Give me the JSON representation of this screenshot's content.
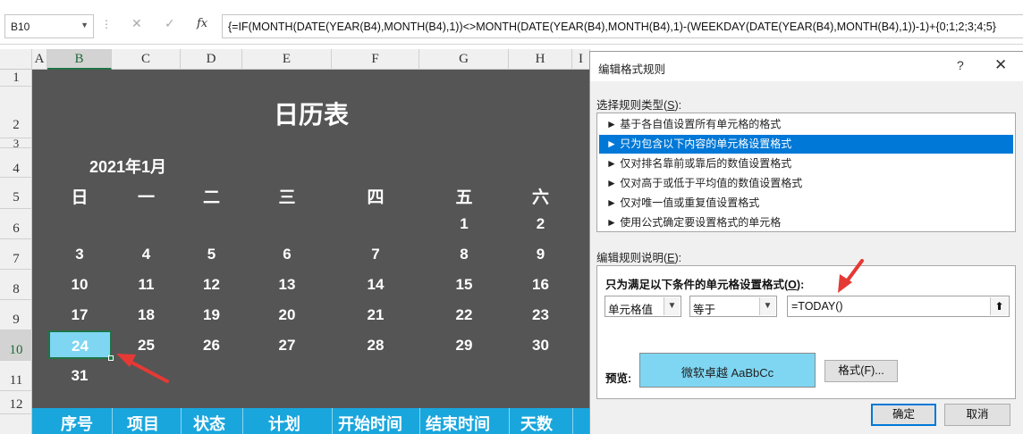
{
  "formula_bar": {
    "name_box": "B10",
    "dots": "⋮",
    "cancel_icon": "✕",
    "enter_icon": "✓",
    "fx_label": "fx",
    "formula": "{=IF(MONTH(DATE(YEAR(B4),MONTH(B4),1))<>MONTH(DATE(YEAR(B4),MONTH(B4),1)-(WEEKDAY(DATE(YEAR(B4),MONTH(B4),1))-1)+{0;1;2;3;4;5}"
  },
  "grid": {
    "columns": [
      "A",
      "B",
      "C",
      "D",
      "E",
      "F",
      "G",
      "H",
      "I"
    ],
    "rows": [
      "1",
      "2",
      "3",
      "4",
      "5",
      "6",
      "7",
      "8",
      "9",
      "10",
      "11",
      "12"
    ],
    "selected_column": "B",
    "selected_row": "10",
    "title": "日历表",
    "month_label": "2021年1月",
    "weekdays": [
      "日",
      "一",
      "二",
      "三",
      "四",
      "五",
      "六"
    ],
    "weeks": [
      [
        "",
        "",
        "",
        "",
        "",
        "1",
        "2"
      ],
      [
        "3",
        "4",
        "5",
        "6",
        "7",
        "8",
        "9"
      ],
      [
        "10",
        "11",
        "12",
        "13",
        "14",
        "15",
        "16"
      ],
      [
        "17",
        "18",
        "19",
        "20",
        "21",
        "22",
        "23"
      ],
      [
        "24",
        "25",
        "26",
        "27",
        "28",
        "29",
        "30"
      ],
      [
        "31",
        "",
        "",
        "",
        "",
        "",
        ""
      ]
    ],
    "selected_cell_value": "24",
    "table_headers": [
      "序号",
      "项目",
      "状态",
      "计划",
      "开始时间",
      "结束时间",
      "天数"
    ]
  },
  "dialog": {
    "title": "编辑格式规则",
    "help_icon": "?",
    "close_icon": "✕",
    "rule_type_label": "选择规则类型(",
    "rule_type_key": "S",
    "rule_type_suffix": "):",
    "rule_types": [
      "► 基于各自值设置所有单元格的格式",
      "► 只为包含以下内容的单元格设置格式",
      "► 仅对排名靠前或靠后的数值设置格式",
      "► 仅对高于或低于平均值的数值设置格式",
      "► 仅对唯一值或重复值设置格式",
      "► 使用公式确定要设置格式的单元格"
    ],
    "selected_rule_index": 1,
    "desc_label": "编辑规则说明(",
    "desc_key": "E",
    "desc_suffix": "):",
    "condition_label": "只为满足以下条件的单元格设置格式(",
    "condition_key": "O",
    "condition_suffix": "):",
    "cond_type": "单元格值",
    "operator": "等于",
    "formula_value": "=TODAY()",
    "collapse_icon": "⬆",
    "preview_label": "预览:",
    "preview_text": "微软卓越  AaBbCc",
    "format_button": "格式(F)...",
    "ok_button": "确定",
    "cancel_button": "取消",
    "preview_color": "#7fd6f2"
  },
  "colors": {
    "sheet_background": "#555555",
    "header_band": "#19a6dd",
    "selection_border": "#217346",
    "annotation_arrow": "#e53935",
    "selected_rule": "#0078d7"
  }
}
